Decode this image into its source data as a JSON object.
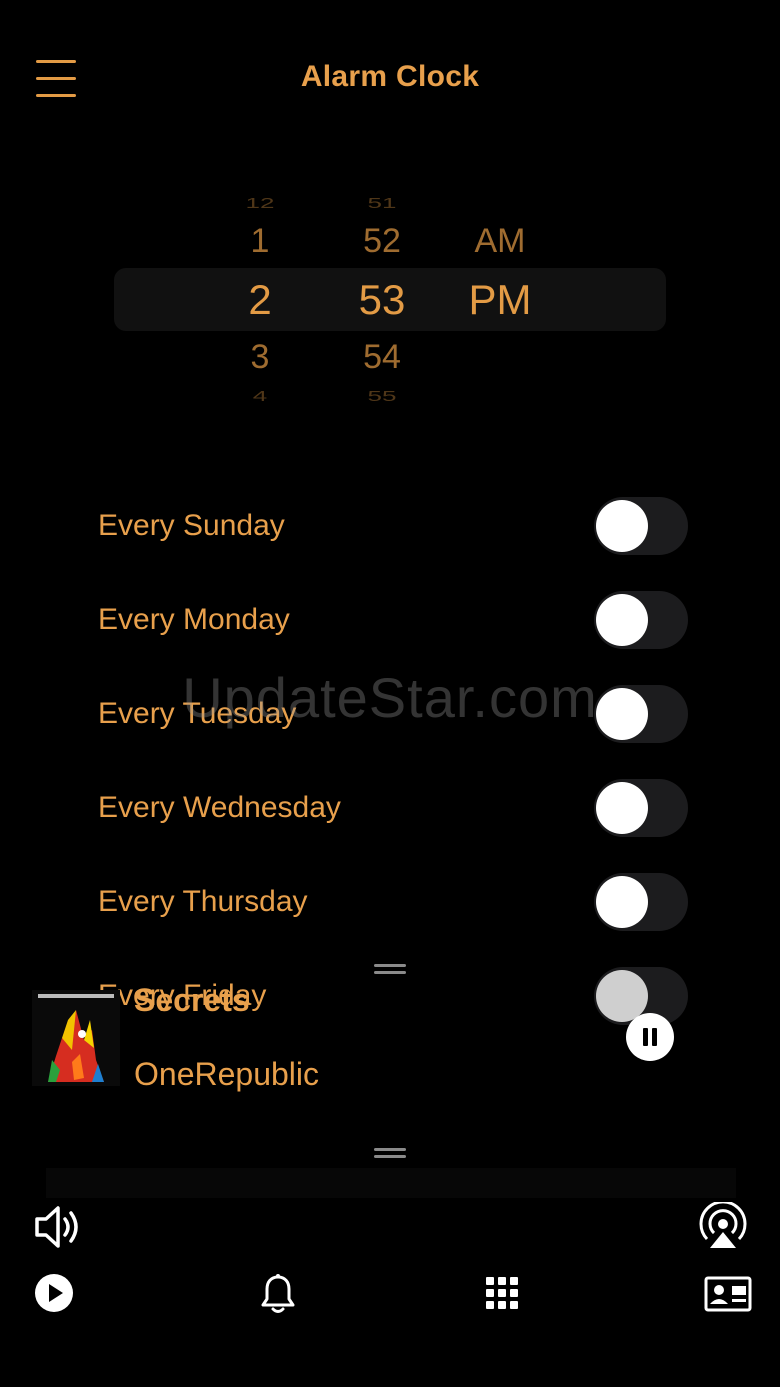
{
  "header": {
    "title": "Alarm Clock",
    "menu_icon": "hamburger-icon"
  },
  "picker": {
    "hours": [
      "12",
      "1",
      "2",
      "3",
      "4"
    ],
    "minutes": [
      "51",
      "52",
      "53",
      "54",
      "55"
    ],
    "ampm": [
      "",
      "AM",
      "PM",
      "",
      ""
    ],
    "selected": {
      "hour": "2",
      "minute": "53",
      "period": "PM"
    }
  },
  "days": [
    {
      "label": "Every Sunday",
      "enabled": false
    },
    {
      "label": "Every Monday",
      "enabled": false
    },
    {
      "label": "Every Tuesday",
      "enabled": false
    },
    {
      "label": "Every Wednesday",
      "enabled": false
    },
    {
      "label": "Every Thursday",
      "enabled": false
    },
    {
      "label": "Every Friday",
      "enabled": false
    }
  ],
  "watermark": "UpdateStar.com",
  "now_playing": {
    "title": "Secrets",
    "artist": "OneRepublic",
    "state": "playing"
  },
  "bottom_bar": {
    "volume_icon": "speaker-icon",
    "airplay_icon": "airplay-icon",
    "tabs": [
      {
        "icon": "play-icon"
      },
      {
        "icon": "bell-icon"
      },
      {
        "icon": "grid-icon"
      },
      {
        "icon": "contact-card-icon"
      }
    ]
  },
  "colors": {
    "accent": "#e39b45",
    "background": "#000000",
    "toggle_track": "#1c1c1e"
  }
}
